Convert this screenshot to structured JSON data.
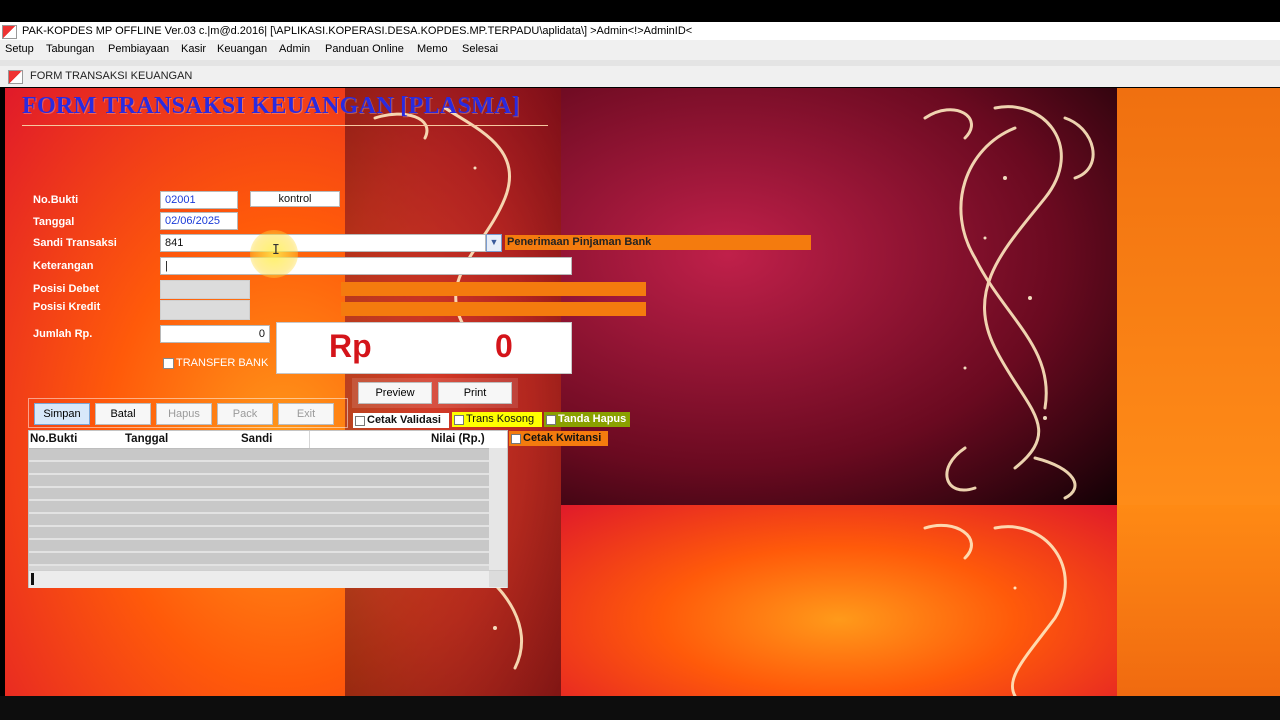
{
  "window": {
    "title": "PAK-KOPDES MP OFFLINE Ver.03 c.|m@d.2016| [\\APLIKASI.KOPERASI.DESA.KOPDES.MP.TERPADU\\aplidata\\] >Admin<!>AdminID<"
  },
  "menu": [
    "Setup",
    "Tabungan",
    "Pembiayaan",
    "Kasir",
    "Keuangan",
    "Admin",
    "Panduan Online",
    "Memo",
    "Selesai"
  ],
  "child_window": {
    "title": "FORM TRANSAKSI KEUANGAN"
  },
  "form": {
    "heading": "FORM TRANSAKSI KEUANGAN [PLASMA]",
    "labels": {
      "no_bukti": "No.Bukti",
      "tanggal": "Tanggal",
      "sandi": "Sandi Transaksi",
      "keterangan": "Keterangan",
      "posisi_debet": "Posisi Debet",
      "posisi_kredit": "Posisi Kredit",
      "jumlah": "Jumlah Rp."
    },
    "values": {
      "no_bukti": "02001",
      "kontrol": "kontrol",
      "tanggal": "02/06/2025",
      "sandi": "841",
      "sandi_desc": "Penerimaan Pinjaman Bank",
      "keterangan": "|",
      "jumlah": "0"
    },
    "transfer_bank": "TRANSFER BANK",
    "rp_label": "Rp",
    "rp_amount": "0"
  },
  "buttons": {
    "simpan": "Simpan",
    "batal": "Batal",
    "hapus": "Hapus",
    "pack": "Pack",
    "exit": "Exit",
    "preview": "Preview",
    "print": "Print"
  },
  "checkboxes": {
    "cetak_validasi": "Cetak Validasi",
    "trans_kosong": "Trans Kosong",
    "tanda_hapus": "Tanda Hapus",
    "cetak_kwitansi": "Cetak Kwitansi"
  },
  "grid": {
    "columns": [
      "No.Bukti",
      "Tanggal",
      "Sandi",
      "Nilai (Rp.)"
    ]
  },
  "colors": {
    "heading": "#2a2adf",
    "accent_orange": "#f47b0e",
    "rp_red": "#d4141a"
  }
}
